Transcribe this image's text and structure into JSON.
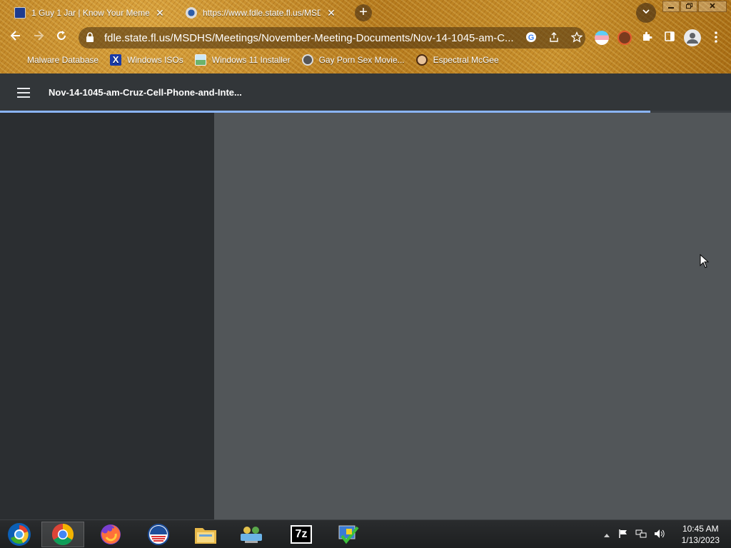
{
  "browser": {
    "tabs": [
      {
        "title": "1 Guy 1 Jar | Know Your Meme",
        "favicon": "knowyourmeme-icon",
        "close": "✕"
      },
      {
        "title": "https://www.fdle.state.fl.us/MSDHS",
        "favicon": "globe-icon",
        "close": "✕"
      }
    ],
    "new_tab_label": "+",
    "url": "fdle.state.fl.us/MSDHS/Meetings/November-Meeting-Documents/Nov-14-1045-am-C...",
    "bookmarks": [
      {
        "label": "Malware Database",
        "icon": "bug-icon"
      },
      {
        "label": "Windows ISOs",
        "icon": "x-logo-icon"
      },
      {
        "label": "Windows 11 Installer",
        "icon": "image-icon"
      },
      {
        "label": "Gay Porn Sex Movie...",
        "icon": "camera-icon"
      },
      {
        "label": "Espectral McGee",
        "icon": "face-icon"
      }
    ],
    "colors": {
      "accent": "#8ab4f8",
      "frame": "#b57a1d"
    }
  },
  "pdf_viewer": {
    "title": "Nov-14-1045-am-Cruz-Cell-Phone-and-Inte...",
    "load_progress": 0.89
  },
  "taskbar": {
    "apps": [
      "windows-start-icon",
      "chrome-icon",
      "firefox-icon",
      "obama-logo-icon",
      "file-explorer-icon",
      "network-icon",
      "7zip-icon",
      "checkmark-app-icon"
    ],
    "seven_zip_label": "7z",
    "time": "10:45 AM",
    "date": "1/13/2023"
  }
}
